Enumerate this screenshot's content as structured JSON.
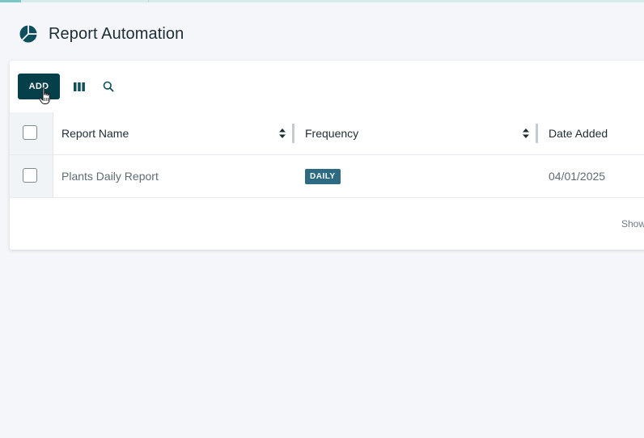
{
  "page": {
    "title": "Report Automation",
    "logo_icon": "pie-chart-icon"
  },
  "toolbar": {
    "add_label": "ADD",
    "columns_icon": "columns-icon",
    "search_icon": "search-icon"
  },
  "table": {
    "columns": [
      {
        "label": "Report Name",
        "sortable": true
      },
      {
        "label": "Frequency",
        "sortable": true
      },
      {
        "label": "Date Added",
        "sortable": false
      }
    ],
    "rows": [
      {
        "report_name": "Plants Daily Report",
        "frequency": "DAILY",
        "date_added": "04/01/2025"
      }
    ],
    "footer_text": "Show"
  },
  "colors": {
    "primary": "#053f4a",
    "badge": "#2d6b82",
    "accent_line": "#7ac8c8",
    "background": "#f5f6f9"
  }
}
